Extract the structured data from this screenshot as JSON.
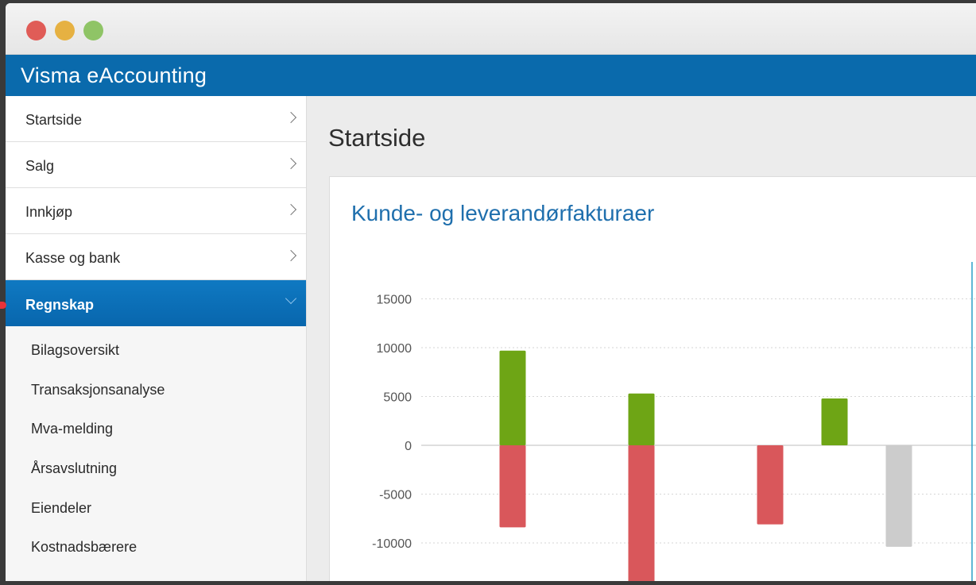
{
  "window": {
    "traffic_lights": [
      "close",
      "minimize",
      "maximize"
    ],
    "colors": {
      "close": "#e05c57",
      "minimize": "#e6b142",
      "maximize": "#8fc466"
    }
  },
  "app": {
    "title": "Visma eAccounting",
    "brand_color": "#0a6aac"
  },
  "sidebar": {
    "items": [
      {
        "label": "Startside",
        "active": false
      },
      {
        "label": "Salg",
        "active": false
      },
      {
        "label": "Innkjøp",
        "active": false
      },
      {
        "label": "Kasse og bank",
        "active": false
      },
      {
        "label": "Regnskap",
        "active": true
      }
    ],
    "subitems": [
      "Bilagsoversikt",
      "Transaksjonsanalyse",
      "Mva-melding",
      "Årsavslutning",
      "Eiendeler",
      "Kostnadsbærere"
    ]
  },
  "main": {
    "page_title": "Startside",
    "card_title": "Kunde- og leverandørfakturaer"
  },
  "chart_data": {
    "type": "bar",
    "title": "Kunde- og leverandørfakturaer",
    "y_ticks": [
      "15000",
      "10000",
      "5000",
      "0",
      "-5000",
      "-10000"
    ],
    "ylim": [
      -14000,
      15000
    ],
    "grid": true,
    "bars": [
      {
        "x_slot": 1,
        "value": 9700,
        "color": "#6ea515"
      },
      {
        "x_slot": 1,
        "value": -8400,
        "color": "#d9575b"
      },
      {
        "x_slot": 3,
        "value": 5300,
        "color": "#6ea515"
      },
      {
        "x_slot": 3,
        "value": -14000,
        "color": "#d9575b"
      },
      {
        "x_slot": 5,
        "value": -8100,
        "color": "#d9575b"
      },
      {
        "x_slot": 6,
        "value": 4800,
        "color": "#6ea515"
      },
      {
        "x_slot": 7,
        "value": -10400,
        "color": "#cccccc"
      }
    ],
    "colors": {
      "positive": "#6ea515",
      "negative": "#d9575b",
      "neutral": "#cccccc",
      "accent_line": "#2a9fc9"
    }
  }
}
